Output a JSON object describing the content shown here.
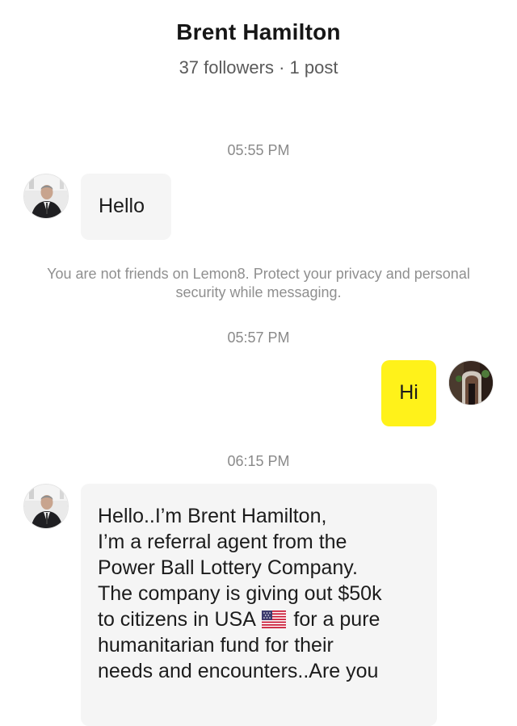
{
  "header": {
    "title": "Brent Hamilton",
    "subtitle": "37 followers · 1 post"
  },
  "chat": {
    "messages": [
      {
        "time": "05:55 PM",
        "sender": "them",
        "text": "Hello"
      },
      {
        "notice": "You are not friends on Lemon8. Protect your privacy and personal security while messaging."
      },
      {
        "time": "05:57 PM",
        "sender": "me",
        "text": "Hi"
      },
      {
        "time": "06:15 PM",
        "sender": "them",
        "text_before_flag": "Hello..I’m Brent Hamilton,\nI’m a referral agent from the\nPower Ball Lottery Company.\nThe company is giving out $50k\nto citizens in USA ",
        "text_after_flag": " for a pure\nhumanitarian fund for their\nneeds and encounters..Are you"
      }
    ]
  },
  "colors": {
    "my_bubble": "#fff21a",
    "their_bubble": "#f5f5f5",
    "timestamp": "#8a8a8a"
  },
  "icons": {
    "flag": "us-flag-icon"
  }
}
